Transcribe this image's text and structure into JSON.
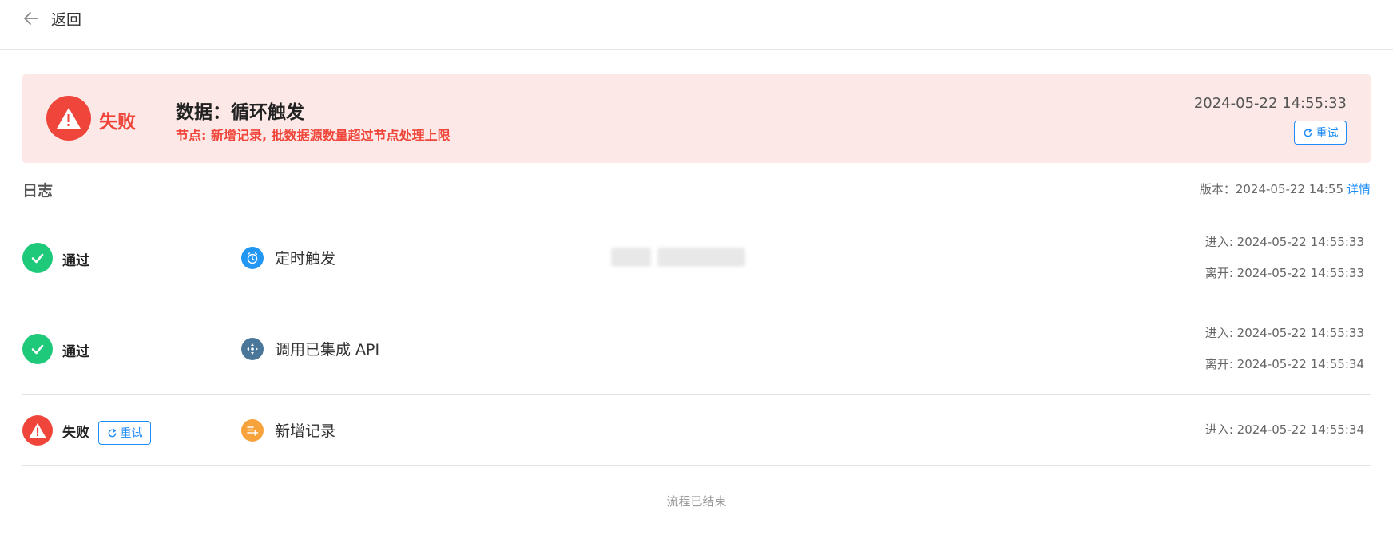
{
  "header": {
    "back_label": "返回"
  },
  "banner": {
    "status": "失败",
    "title": "数据：循环触发",
    "error_message": "节点: 新增记录, 批数据源数量超过节点处理上限",
    "time": "2024-05-22 14:55:33",
    "retry_label": "重试"
  },
  "logs": {
    "label": "日志",
    "version_text": "版本：2024-05-22 14:55",
    "details_link": "详情",
    "rows": [
      {
        "status": "通过",
        "node": "定时触发",
        "enter": "进入: 2024-05-22 14:55:33",
        "leave": "离开: 2024-05-22 14:55:33"
      },
      {
        "status": "通过",
        "node": "调用已集成 API",
        "enter": "进入: 2024-05-22 14:55:33",
        "leave": "离开: 2024-05-22 14:55:34"
      },
      {
        "status": "失败",
        "node": "新增记录",
        "retry_label": "重试",
        "enter": "进入: 2024-05-22 14:55:34"
      }
    ]
  },
  "footer": {
    "text": "流程已结束"
  },
  "colors": {
    "success": "#1ec97a",
    "error": "#f0453a",
    "link": "#1d8cf8",
    "banner_bg": "#fce9e7"
  },
  "icons": [
    "arrow-left-icon",
    "warning-icon",
    "refresh-icon",
    "check-icon",
    "clock-icon",
    "api-icon",
    "add-record-icon"
  ]
}
